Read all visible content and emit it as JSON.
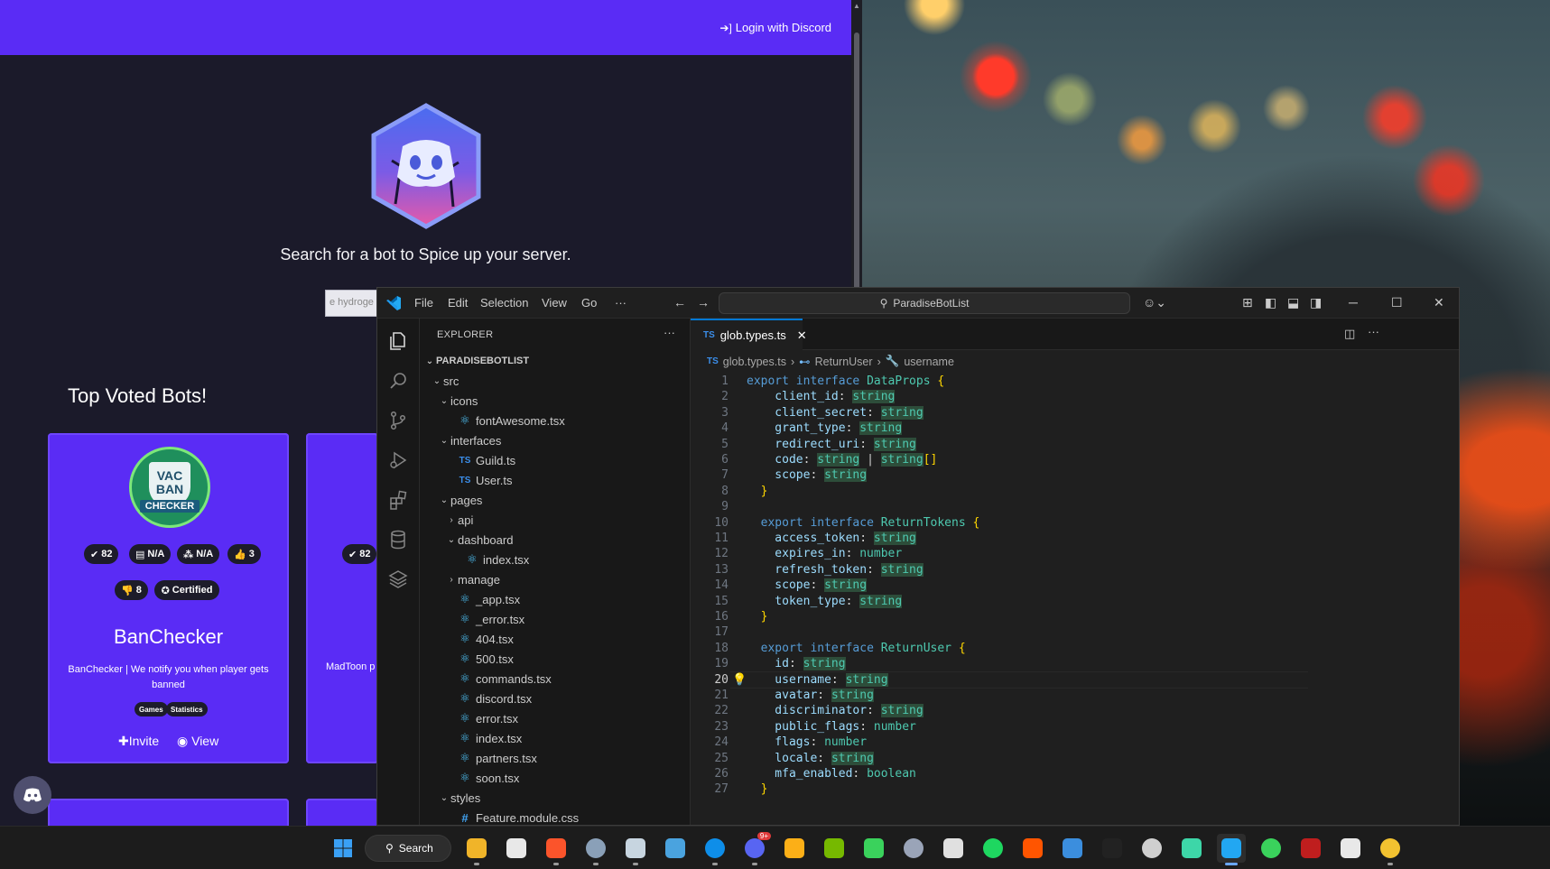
{
  "browser": {
    "nav": {
      "login_label": "Login with Discord"
    },
    "hero": {
      "tagline": "Search for a bot to Spice up your server.",
      "search_placeholder": "e hydroge"
    },
    "section_title": "Top Voted Bots!",
    "card1": {
      "logo_line1": "VAC",
      "logo_line2": "BAN",
      "logo_ribbon": "CHECKER",
      "stats": [
        "82",
        "N/A",
        "N/A",
        "3",
        "8"
      ],
      "certified": "Certified",
      "name": "BanChecker",
      "description": "BanChecker | We notify you when player gets banned",
      "tags": [
        "Games",
        "Statistics"
      ],
      "invite_label": "Invite",
      "view_label": "View"
    },
    "card2": {
      "stat": "82",
      "description": "MadToon p"
    }
  },
  "vscode": {
    "menu": [
      "File",
      "Edit",
      "Selection",
      "View",
      "Go",
      "···"
    ],
    "command_center": "ParadiseBotList",
    "explorer_title": "EXPLORER",
    "project": "PARADISEBOTLIST",
    "tree": [
      {
        "label": "src",
        "type": "folder-open",
        "depth": 1
      },
      {
        "label": "icons",
        "type": "folder-open",
        "depth": 2
      },
      {
        "label": "fontAwesome.tsx",
        "type": "react",
        "depth": 3
      },
      {
        "label": "interfaces",
        "type": "folder-open",
        "depth": 2
      },
      {
        "label": "Guild.ts",
        "type": "ts",
        "depth": 3
      },
      {
        "label": "User.ts",
        "type": "ts",
        "depth": 3
      },
      {
        "label": "pages",
        "type": "folder-open",
        "depth": 2
      },
      {
        "label": "api",
        "type": "folder-closed",
        "depth": 3
      },
      {
        "label": "dashboard",
        "type": "folder-open",
        "depth": 3
      },
      {
        "label": "index.tsx",
        "type": "react",
        "depth": 4
      },
      {
        "label": "manage",
        "type": "folder-closed",
        "depth": 3
      },
      {
        "label": "_app.tsx",
        "type": "react",
        "depth": 3
      },
      {
        "label": "_error.tsx",
        "type": "react",
        "depth": 3
      },
      {
        "label": "404.tsx",
        "type": "react",
        "depth": 3
      },
      {
        "label": "500.tsx",
        "type": "react",
        "depth": 3
      },
      {
        "label": "commands.tsx",
        "type": "react",
        "depth": 3
      },
      {
        "label": "discord.tsx",
        "type": "react",
        "depth": 3
      },
      {
        "label": "error.tsx",
        "type": "react",
        "depth": 3
      },
      {
        "label": "index.tsx",
        "type": "react",
        "depth": 3
      },
      {
        "label": "partners.tsx",
        "type": "react",
        "depth": 3
      },
      {
        "label": "soon.tsx",
        "type": "react",
        "depth": 3
      },
      {
        "label": "styles",
        "type": "folder-open",
        "depth": 2
      },
      {
        "label": "Feature.module.css",
        "type": "css",
        "depth": 3
      }
    ],
    "tab": {
      "lang": "TS",
      "name": "glob.types.ts"
    },
    "breadcrumbs": [
      "glob.types.ts",
      "ReturnUser",
      "username"
    ],
    "current_line": 20,
    "code": [
      [
        [
          "kw",
          "export "
        ],
        [
          "kw",
          "interface "
        ],
        [
          "ty",
          "DataProps "
        ],
        [
          "br",
          "{"
        ]
      ],
      [
        [
          "pr",
          "    client_id"
        ],
        [
          "pn",
          ": "
        ],
        [
          "hl",
          "string"
        ]
      ],
      [
        [
          "pr",
          "    client_secret"
        ],
        [
          "pn",
          ": "
        ],
        [
          "hl",
          "string"
        ]
      ],
      [
        [
          "pr",
          "    grant_type"
        ],
        [
          "pn",
          ": "
        ],
        [
          "hl",
          "string"
        ]
      ],
      [
        [
          "pr",
          "    redirect_uri"
        ],
        [
          "pn",
          ": "
        ],
        [
          "hl",
          "string"
        ]
      ],
      [
        [
          "pr",
          "    code"
        ],
        [
          "pn",
          ": "
        ],
        [
          "hl",
          "string"
        ],
        [
          "pn",
          " | "
        ],
        [
          "hl",
          "string"
        ],
        [
          "br",
          "[]"
        ]
      ],
      [
        [
          "pr",
          "    scope"
        ],
        [
          "pn",
          ": "
        ],
        [
          "hl",
          "string"
        ]
      ],
      [
        [
          "br",
          "  }"
        ]
      ],
      [],
      [
        [
          "kw",
          "  export "
        ],
        [
          "kw",
          "interface "
        ],
        [
          "ty",
          "ReturnTokens "
        ],
        [
          "br",
          "{"
        ]
      ],
      [
        [
          "pr",
          "    access_token"
        ],
        [
          "pn",
          ": "
        ],
        [
          "hl",
          "string"
        ]
      ],
      [
        [
          "pr",
          "    expires_in"
        ],
        [
          "pn",
          ": "
        ],
        [
          "ty",
          "number"
        ]
      ],
      [
        [
          "pr",
          "    refresh_token"
        ],
        [
          "pn",
          ": "
        ],
        [
          "hl",
          "string"
        ]
      ],
      [
        [
          "pr",
          "    scope"
        ],
        [
          "pn",
          ": "
        ],
        [
          "hl",
          "string"
        ]
      ],
      [
        [
          "pr",
          "    token_type"
        ],
        [
          "pn",
          ": "
        ],
        [
          "hl",
          "string"
        ]
      ],
      [
        [
          "br",
          "  }"
        ]
      ],
      [],
      [
        [
          "kw",
          "  export "
        ],
        [
          "kw",
          "interface "
        ],
        [
          "ty",
          "ReturnUser "
        ],
        [
          "br",
          "{"
        ]
      ],
      [
        [
          "pr",
          "    id"
        ],
        [
          "pn",
          ": "
        ],
        [
          "hl",
          "string"
        ]
      ],
      [
        [
          "pr",
          "    username"
        ],
        [
          "pn",
          ": "
        ],
        [
          "hl",
          "string"
        ]
      ],
      [
        [
          "pr",
          "    avatar"
        ],
        [
          "pn",
          ": "
        ],
        [
          "hl",
          "string"
        ]
      ],
      [
        [
          "pr",
          "    discriminator"
        ],
        [
          "pn",
          ": "
        ],
        [
          "hl",
          "string"
        ]
      ],
      [
        [
          "pr",
          "    public_flags"
        ],
        [
          "pn",
          ": "
        ],
        [
          "ty",
          "number"
        ]
      ],
      [
        [
          "pr",
          "    flags"
        ],
        [
          "pn",
          ": "
        ],
        [
          "ty",
          "number"
        ]
      ],
      [
        [
          "pr",
          "    locale"
        ],
        [
          "pn",
          ": "
        ],
        [
          "hl",
          "string"
        ]
      ],
      [
        [
          "pr",
          "    mfa_enabled"
        ],
        [
          "pn",
          ": "
        ],
        [
          "ty",
          "boolean"
        ]
      ],
      [
        [
          "br",
          "  }"
        ]
      ]
    ]
  },
  "taskbar": {
    "search_label": "Search",
    "apps": [
      {
        "name": "file-explorer",
        "color": "#f0b429"
      },
      {
        "name": "microsoft-store",
        "color": "#e8e8e8"
      },
      {
        "name": "brave",
        "color": "#fb542b"
      },
      {
        "name": "settings",
        "color": "#8aa0b8"
      },
      {
        "name": "steam",
        "color": "#c7d5e0"
      },
      {
        "name": "remote-desktop",
        "color": "#4aa3df"
      },
      {
        "name": "teamviewer",
        "color": "#0e8ee9"
      },
      {
        "name": "discord",
        "color": "#5865f2",
        "badge": "9+"
      },
      {
        "name": "rockstar",
        "color": "#fcaf17"
      },
      {
        "name": "nvidia",
        "color": "#76b900"
      },
      {
        "name": "gamepass",
        "color": "#3ad25c"
      },
      {
        "name": "onscreen-keyboard",
        "color": "#9aa4b8"
      },
      {
        "name": "pinwheel",
        "color": "#e0e0e0"
      },
      {
        "name": "spotify",
        "color": "#1ed760"
      },
      {
        "name": "soundcloud",
        "color": "#ff5500"
      },
      {
        "name": "powershell",
        "color": "#3b8ede"
      },
      {
        "name": "nest-dark",
        "color": "#222222"
      },
      {
        "name": "kali",
        "color": "#cfcfcf"
      },
      {
        "name": "github-desktop",
        "color": "#3dd6a8"
      },
      {
        "name": "vscode",
        "color": "#22a7f2"
      },
      {
        "name": "xbox",
        "color": "#3ad25c"
      },
      {
        "name": "filezilla",
        "color": "#bf1e1e"
      },
      {
        "name": "news",
        "color": "#e8e8e8"
      },
      {
        "name": "chrome",
        "color": "#f2c230"
      }
    ]
  }
}
